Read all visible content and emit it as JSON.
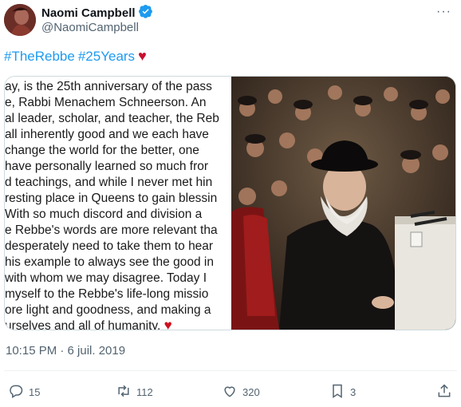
{
  "author": {
    "display_name": "Naomi Campbell",
    "handle": "@NaomiCampbell",
    "verified": true
  },
  "tweet": {
    "hashtag1": "#TheRebbe",
    "hashtag2": "#25Years",
    "heart": "♥"
  },
  "media_text_lines": [
    "ay, is the 25th anniversary of the pass",
    "e, Rabbi Menachem Schneerson.  An",
    "al leader, scholar, and teacher, the Reb",
    " all inherently good and we each have",
    " change the world for the better, one",
    " have personally learned so much fror",
    "d teachings, and while I never met hin",
    "resting place in Queens to gain blessin",
    " With so much discord and division a",
    "e Rebbe's words are more relevant tha",
    "desperately need to take them to hear",
    "his example to always see the good in",
    " with whom we may disagree.  Today I",
    " myself to the Rebbe's life-long missio",
    "ore light and goodness, and making a",
    "urselves and all of humanity."
  ],
  "media_heart": "♥",
  "timestamp": "10:15 PM · 6 juil. 2019",
  "actions": {
    "replies": "15",
    "retweets": "112",
    "likes": "320",
    "bookmarks": "3"
  },
  "more_icon": "···",
  "colors": {
    "accent": "#1d9bf0",
    "heart": "#d0101e",
    "muted": "#536471"
  }
}
